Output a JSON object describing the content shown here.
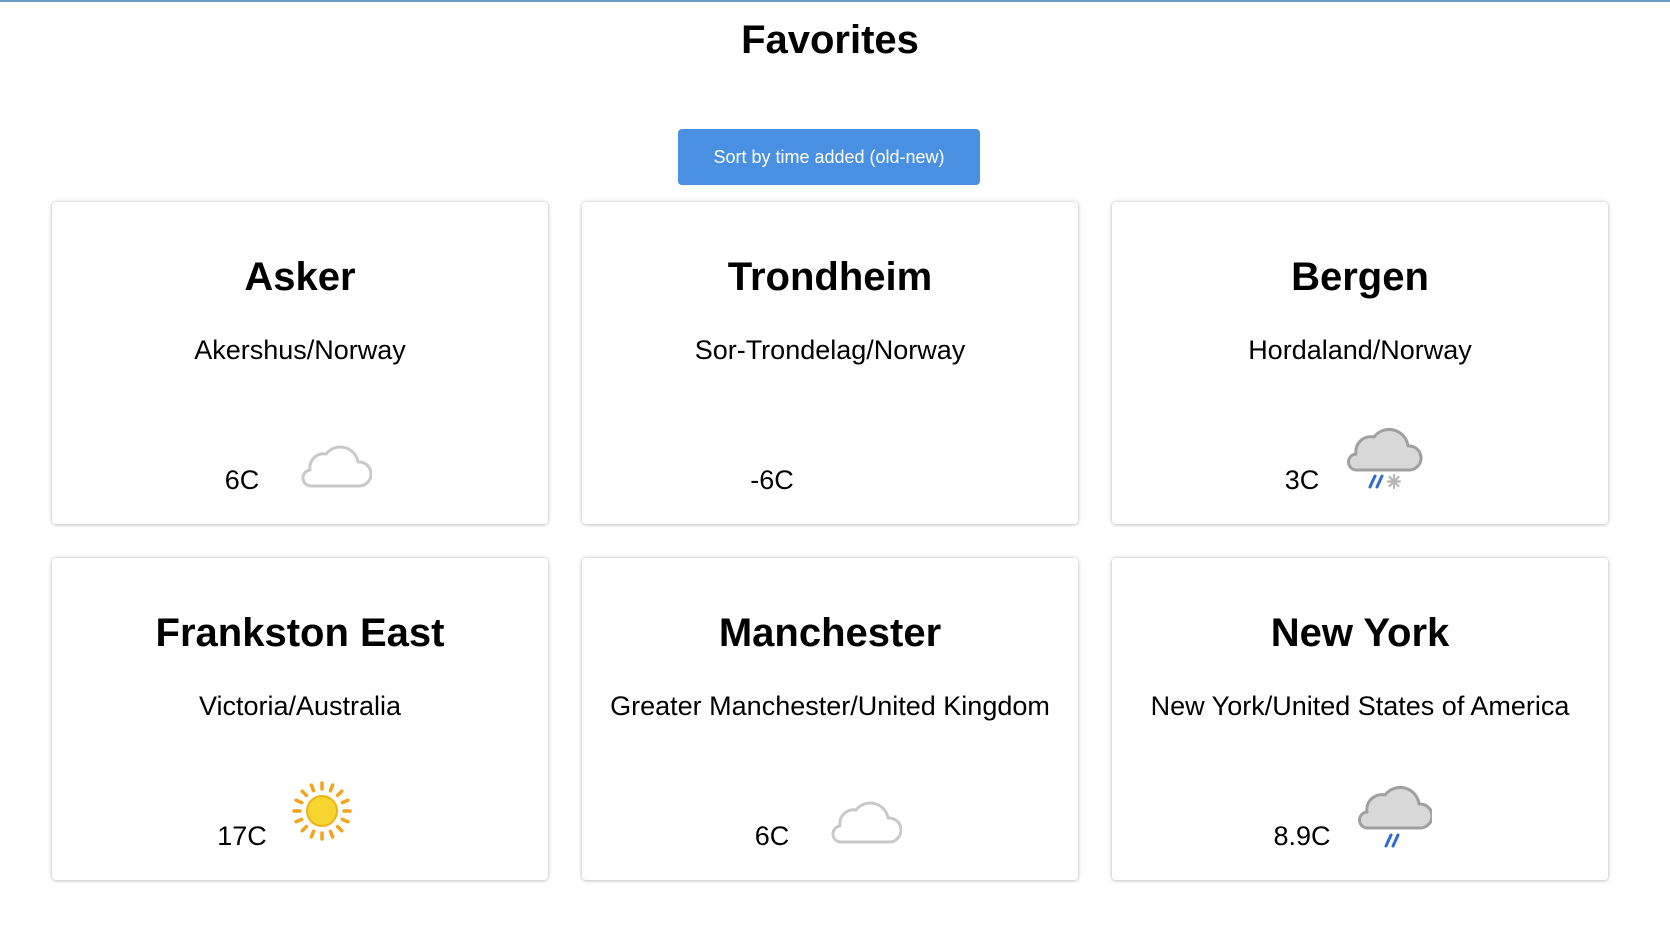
{
  "page": {
    "title": "Favorites",
    "accent_color": "#4a90e2"
  },
  "sort_button": {
    "label": "Sort by time added (old-new)"
  },
  "favorites": [
    {
      "city": "Asker",
      "region": "Akershus/Norway",
      "temperature": "6C",
      "icon": "moon-cloud-icon"
    },
    {
      "city": "Trondheim",
      "region": "Sor-Trondelag/Norway",
      "temperature": "-6C",
      "icon": "moon-icon"
    },
    {
      "city": "Bergen",
      "region": "Hordaland/Norway",
      "temperature": "3C",
      "icon": "sleet-cloud-icon"
    },
    {
      "city": "Frankston East",
      "region": "Victoria/Australia",
      "temperature": "17C",
      "icon": "sun-icon"
    },
    {
      "city": "Manchester",
      "region": "Greater Manchester/United Kingdom",
      "temperature": "6C",
      "icon": "moon-cloud-icon"
    },
    {
      "city": "New York",
      "region": "New York/United States of America",
      "temperature": "8.9C",
      "icon": "rain-cloud-icon"
    }
  ]
}
